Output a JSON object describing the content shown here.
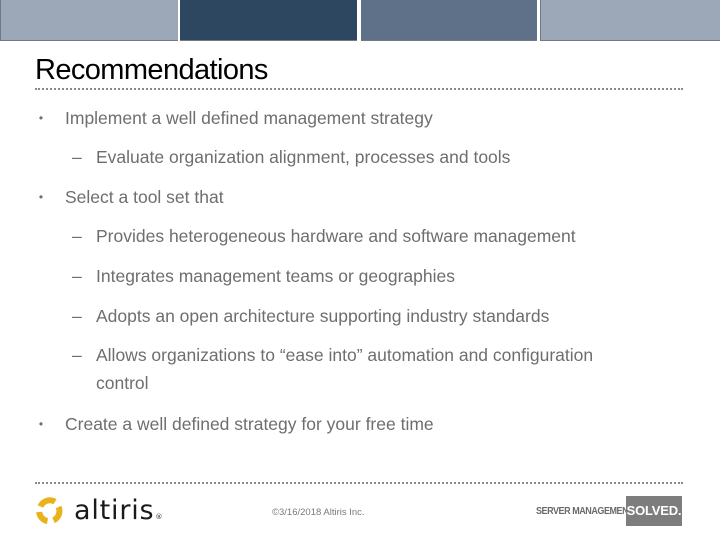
{
  "header": {
    "decor_blocks": [
      {
        "name": "light",
        "color": "#9ca8b8"
      },
      {
        "name": "dark",
        "color": "#2e4761"
      },
      {
        "name": "medium",
        "color": "#5f7089"
      },
      {
        "name": "light",
        "color": "#9ca8b8"
      }
    ]
  },
  "slide": {
    "title": "Recommendations",
    "bullet_glyph": "•",
    "dash_glyph": "–",
    "items": [
      {
        "level": 1,
        "text": "Implement a well defined management strategy"
      },
      {
        "level": 2,
        "text": "Evaluate organization alignment, processes and tools"
      },
      {
        "level": 1,
        "text": "Select a tool set that"
      },
      {
        "level": 2,
        "text": "Provides heterogeneous hardware and software management"
      },
      {
        "level": 2,
        "text": "Integrates management teams or geographies"
      },
      {
        "level": 2,
        "text": "Adopts an open architecture supporting industry standards"
      },
      {
        "level": 2,
        "text": "Allows organizations to “ease into” automation and configuration",
        "continuation": "control"
      },
      {
        "level": 1,
        "text": "Create a well defined strategy for your free time"
      }
    ]
  },
  "footer": {
    "logo_icon": "altiris-swirl-icon",
    "wordmark": "altiris",
    "registered_mark": "®",
    "copyright": "©3/16/2018 Altiris Inc.",
    "tagline": "SERVER MANAGEMENT.",
    "badge": "SOLVED.",
    "brand_color": "#e9b21d"
  }
}
